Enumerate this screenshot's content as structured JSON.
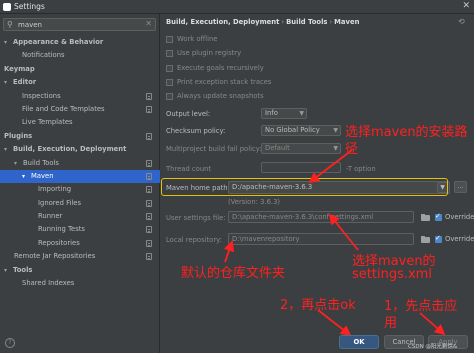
{
  "window": {
    "title": "Settings",
    "close_glyph": "✕"
  },
  "search": {
    "value": "maven",
    "clear_glyph": "✕"
  },
  "tree": [
    {
      "label": "Appearance & Behavior",
      "level": 0,
      "arrow": "▾",
      "bold": true,
      "badge": false,
      "selected": false
    },
    {
      "label": "Notifications",
      "level": 2,
      "arrow": "",
      "bold": false,
      "badge": false,
      "selected": false
    },
    {
      "label": "Keymap",
      "level": 0,
      "arrow": "",
      "bold": true,
      "badge": false,
      "selected": false
    },
    {
      "label": "Editor",
      "level": 0,
      "arrow": "▾",
      "bold": true,
      "badge": false,
      "selected": false
    },
    {
      "label": "Inspections",
      "level": 2,
      "arrow": "",
      "bold": false,
      "badge": true,
      "selected": false
    },
    {
      "label": "File and Code Templates",
      "level": 2,
      "arrow": "",
      "bold": false,
      "badge": true,
      "selected": false
    },
    {
      "label": "Live Templates",
      "level": 2,
      "arrow": "",
      "bold": false,
      "badge": false,
      "selected": false
    },
    {
      "label": "Plugins",
      "level": 0,
      "arrow": "",
      "bold": true,
      "badge": true,
      "selected": false
    },
    {
      "label": "Build, Execution, Deployment",
      "level": 0,
      "arrow": "▾",
      "bold": true,
      "badge": false,
      "selected": false
    },
    {
      "label": "Build Tools",
      "level": 1,
      "arrow": "▾",
      "bold": false,
      "badge": true,
      "selected": false
    },
    {
      "label": "Maven",
      "level": 2,
      "arrow": "▾",
      "bold": false,
      "badge": true,
      "selected": true
    },
    {
      "label": "Importing",
      "level": 3,
      "arrow": "",
      "bold": false,
      "badge": true,
      "selected": false
    },
    {
      "label": "Ignored Files",
      "level": 3,
      "arrow": "",
      "bold": false,
      "badge": true,
      "selected": false
    },
    {
      "label": "Runner",
      "level": 3,
      "arrow": "",
      "bold": false,
      "badge": true,
      "selected": false
    },
    {
      "label": "Running Tests",
      "level": 3,
      "arrow": "",
      "bold": false,
      "badge": true,
      "selected": false
    },
    {
      "label": "Repositories",
      "level": 3,
      "arrow": "",
      "bold": false,
      "badge": true,
      "selected": false
    },
    {
      "label": "Remote Jar Repositories",
      "level": 1,
      "arrow": "",
      "bold": false,
      "badge": true,
      "selected": false
    },
    {
      "label": "Tools",
      "level": 0,
      "arrow": "▾",
      "bold": true,
      "badge": false,
      "selected": false
    },
    {
      "label": "Shared Indexes",
      "level": 2,
      "arrow": "",
      "bold": false,
      "badge": false,
      "selected": false
    }
  ],
  "breadcrumb": {
    "parts": [
      "Build, Execution, Deployment",
      "Build Tools",
      "Maven"
    ],
    "sep": "›",
    "reset_glyph": "⟲"
  },
  "checkboxes": [
    {
      "label": "Work offline"
    },
    {
      "label": "Use plugin registry"
    },
    {
      "label": "Execute goals recursively"
    },
    {
      "label": "Print exception stack traces"
    },
    {
      "label": "Always update snapshots"
    }
  ],
  "output_level": {
    "label": "Output level:",
    "value": "Info"
  },
  "checksum_policy": {
    "label": "Checksum policy:",
    "value": "No Global Policy"
  },
  "multiproject_policy": {
    "label": "Multiproject build fail policy:",
    "value": "Default"
  },
  "thread_count": {
    "label": "Thread count",
    "hint": "-T option"
  },
  "maven_home": {
    "label": "Maven home path:",
    "value": "D:/apache-maven-3.6.3",
    "version": "(Version: 3.6.3)"
  },
  "user_settings": {
    "label": "User settings file:",
    "value": "D:\\apache-maven-3.6.3\\conf\\settings.xml",
    "override": "Override"
  },
  "local_repo": {
    "label": "Local repository:",
    "value": "D:\\mavenrepository",
    "override": "Override"
  },
  "annotations": {
    "select_maven": "选择maven的安装路",
    "select_maven_2": "径",
    "select_settings": "选择maven的",
    "select_settings_2": "settings.xml",
    "default_repo": "默认的仓库文件夹",
    "step2": "2，再点击ok",
    "step1": "1，先点击应",
    "step1_2": "用"
  },
  "buttons": {
    "ok": "OK",
    "cancel": "Cancel",
    "apply": "Apply",
    "help": "?"
  },
  "watermark": "CSDN @阳光剩馀&",
  "colors": {
    "accent_selected": "#2f65ca",
    "annotation_red": "#ff2020",
    "highlight_yellow": "#e6c200"
  }
}
